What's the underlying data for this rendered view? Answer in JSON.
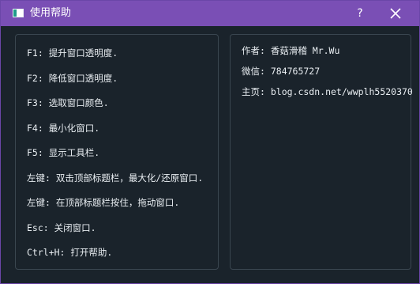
{
  "window": {
    "title": "使用帮助",
    "help_label": "?",
    "close_icon": "close-icon",
    "app_icon": "window-icon",
    "colors": {
      "titlebar": "#7a4fb5",
      "background": "#1a232b",
      "panel_border": "#3a4650",
      "text": "#e9eef2"
    }
  },
  "shortcuts": [
    "F1: 提升窗口透明度.",
    "F2: 降低窗口透明度.",
    "F3: 选取窗口颜色.",
    "F4: 最小化窗口.",
    "F5: 显示工具栏.",
    "左键: 双击顶部标题栏，最大化/还原窗口.",
    "左键: 在顶部标题栏按住，拖动窗口.",
    "Esc: 关闭窗口.",
    "Ctrl+H: 打开帮助."
  ],
  "about": {
    "author": "作者: 香菇滑稽 Mr.Wu",
    "wechat": "微信: 784765727",
    "homepage": "主页: blog.csdn.net/wwplh5520370"
  }
}
